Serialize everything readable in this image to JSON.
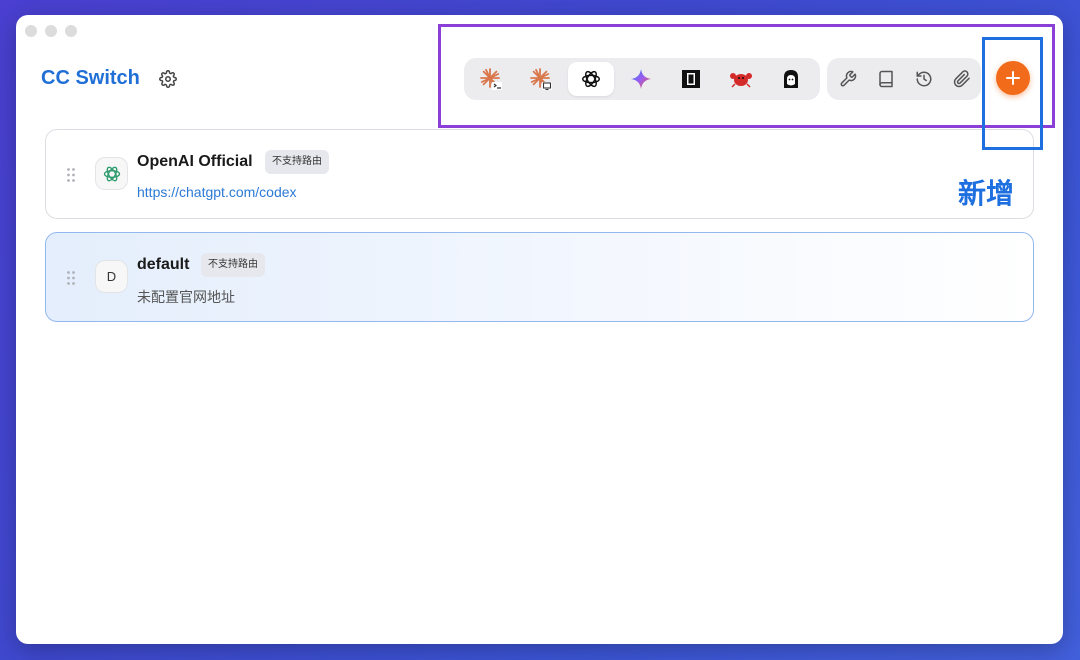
{
  "app": {
    "title": "CC Switch"
  },
  "toolbar": {
    "apps": [
      {
        "icon": "claude-code-icon",
        "active": false
      },
      {
        "icon": "claude-desktop-icon",
        "active": false
      },
      {
        "icon": "openai-icon",
        "active": true
      },
      {
        "icon": "gemini-icon",
        "active": false
      },
      {
        "icon": "black-square-app-icon",
        "active": false
      },
      {
        "icon": "red-crab-icon",
        "active": false
      },
      {
        "icon": "character-avatar-icon",
        "active": false
      }
    ],
    "tools": [
      {
        "icon": "wrench-icon"
      },
      {
        "icon": "book-icon"
      },
      {
        "icon": "history-icon"
      },
      {
        "icon": "paperclip-icon"
      }
    ],
    "add_icon": "plus-icon"
  },
  "providers": [
    {
      "name": "OpenAI Official",
      "badge": "不支持路由",
      "url": "https://chatgpt.com/codex",
      "avatar_icon": "openai-icon",
      "selected": false
    },
    {
      "name": "default",
      "badge": "不支持路由",
      "subtitle": "未配置官网地址",
      "avatar_letter": "D",
      "selected": true
    }
  ],
  "annotation": {
    "label": "新增"
  },
  "colors": {
    "brand": "#1f6fd6",
    "add_button": "#f26b1a",
    "annotation_purple": "#8a3fd6",
    "annotation_blue": "#1e6fe0",
    "selected_border": "#93b8ee"
  }
}
